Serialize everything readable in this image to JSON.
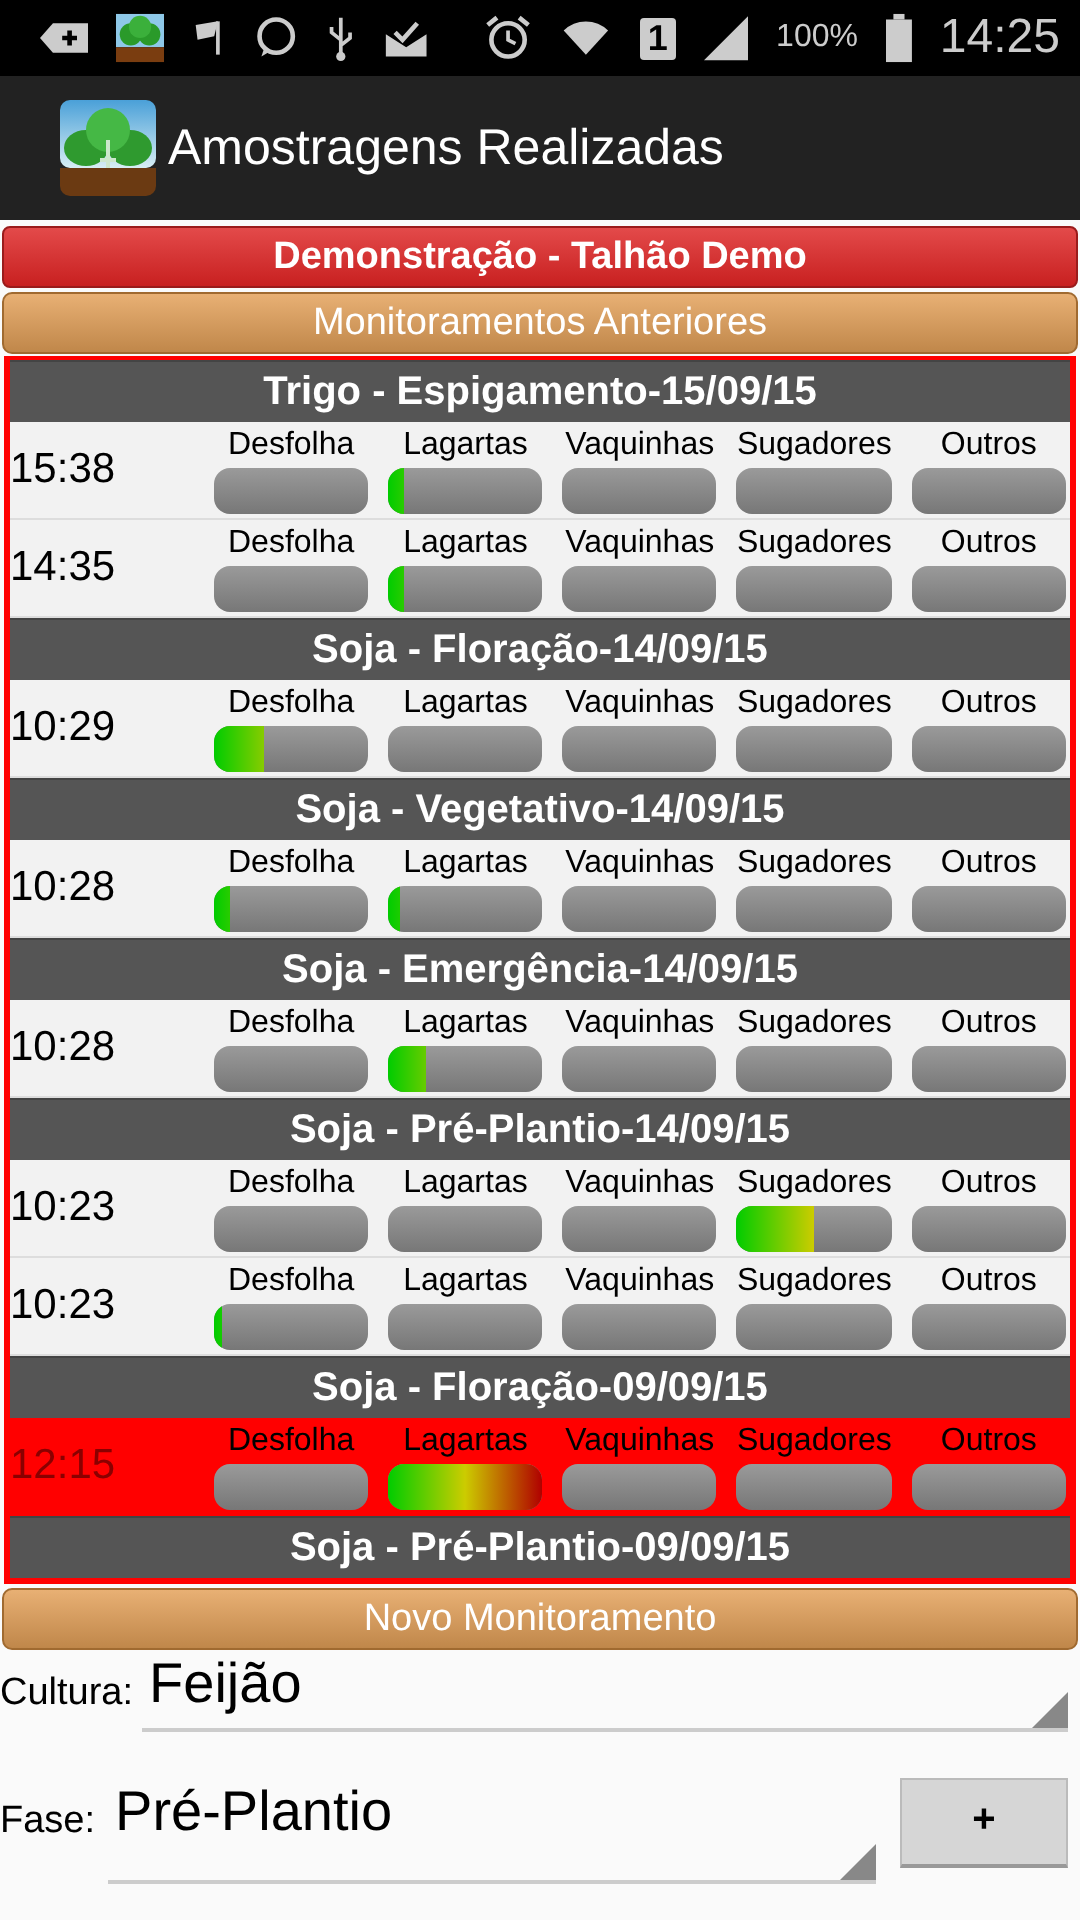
{
  "status_bar": {
    "sim_slot": "1",
    "battery": "100%",
    "time": "14:25"
  },
  "app_bar": {
    "title": "Amostragens Realizadas"
  },
  "field_banner": "Demonstração - Talhão Demo",
  "history_button": "Monitoramentos Anteriores",
  "groups": [
    {
      "title": "Trigo - Espigamento-15/09/15",
      "rows": [
        {
          "time": "15:38",
          "selected": false,
          "meters": [
            {
              "label": "Desfolha",
              "level": 0
            },
            {
              "label": "Lagartas",
              "level": 0.1
            },
            {
              "label": "Vaquinhas",
              "level": 0
            },
            {
              "label": "Sugadores",
              "level": 0
            },
            {
              "label": "Outros",
              "level": 0
            }
          ]
        },
        {
          "time": "14:35",
          "selected": false,
          "meters": [
            {
              "label": "Desfolha",
              "level": 0
            },
            {
              "label": "Lagartas",
              "level": 0.1
            },
            {
              "label": "Vaquinhas",
              "level": 0
            },
            {
              "label": "Sugadores",
              "level": 0
            },
            {
              "label": "Outros",
              "level": 0
            }
          ]
        }
      ]
    },
    {
      "title": "Soja - Floração-14/09/15",
      "rows": [
        {
          "time": "10:29",
          "selected": false,
          "meters": [
            {
              "label": "Desfolha",
              "level": 0.33
            },
            {
              "label": "Lagartas",
              "level": 0
            },
            {
              "label": "Vaquinhas",
              "level": 0
            },
            {
              "label": "Sugadores",
              "level": 0
            },
            {
              "label": "Outros",
              "level": 0
            }
          ]
        }
      ]
    },
    {
      "title": "Soja - Vegetativo-14/09/15",
      "rows": [
        {
          "time": "10:28",
          "selected": false,
          "meters": [
            {
              "label": "Desfolha",
              "level": 0.1
            },
            {
              "label": "Lagartas",
              "level": 0.07
            },
            {
              "label": "Vaquinhas",
              "level": 0
            },
            {
              "label": "Sugadores",
              "level": 0
            },
            {
              "label": "Outros",
              "level": 0
            }
          ]
        }
      ]
    },
    {
      "title": "Soja - Emergência-14/09/15",
      "rows": [
        {
          "time": "10:28",
          "selected": false,
          "meters": [
            {
              "label": "Desfolha",
              "level": 0
            },
            {
              "label": "Lagartas",
              "level": 0.25
            },
            {
              "label": "Vaquinhas",
              "level": 0
            },
            {
              "label": "Sugadores",
              "level": 0
            },
            {
              "label": "Outros",
              "level": 0
            }
          ]
        }
      ]
    },
    {
      "title": "Soja - Pré-Plantio-14/09/15",
      "rows": [
        {
          "time": "10:23",
          "selected": false,
          "meters": [
            {
              "label": "Desfolha",
              "level": 0
            },
            {
              "label": "Lagartas",
              "level": 0
            },
            {
              "label": "Vaquinhas",
              "level": 0
            },
            {
              "label": "Sugadores",
              "level": 0.5
            },
            {
              "label": "Outros",
              "level": 0
            }
          ]
        },
        {
          "time": "10:23",
          "selected": false,
          "meters": [
            {
              "label": "Desfolha",
              "level": 0.05
            },
            {
              "label": "Lagartas",
              "level": 0
            },
            {
              "label": "Vaquinhas",
              "level": 0
            },
            {
              "label": "Sugadores",
              "level": 0
            },
            {
              "label": "Outros",
              "level": 0
            }
          ]
        }
      ]
    },
    {
      "title": "Soja - Floração-09/09/15",
      "rows": [
        {
          "time": "12:15",
          "selected": true,
          "meters": [
            {
              "label": "Desfolha",
              "level": 0
            },
            {
              "label": "Lagartas",
              "level": 1
            },
            {
              "label": "Vaquinhas",
              "level": 0
            },
            {
              "label": "Sugadores",
              "level": 0
            },
            {
              "label": "Outros",
              "level": 0
            }
          ]
        }
      ]
    },
    {
      "title": "Soja - Pré-Plantio-09/09/15"
    }
  ],
  "new_button": "Novo Monitoramento",
  "form": {
    "crop": {
      "label": "Cultura:",
      "value": "Feijão"
    },
    "phase": {
      "label": "Fase:",
      "value": "Pré-Plantio"
    },
    "add_button": "+"
  }
}
